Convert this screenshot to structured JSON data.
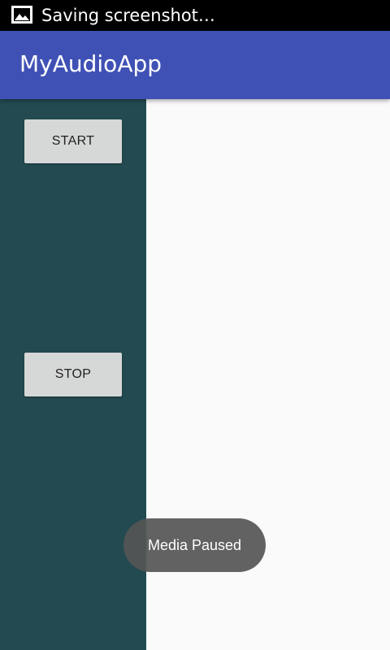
{
  "status_bar": {
    "notification_icon": "image-icon",
    "text": "Saving screenshot…"
  },
  "app_bar": {
    "title": "MyAudioApp",
    "color": "#3f51b5"
  },
  "left_panel": {
    "color": "#234a50",
    "start_label": "START",
    "stop_label": "STOP"
  },
  "toast": {
    "text": "Media Paused"
  }
}
